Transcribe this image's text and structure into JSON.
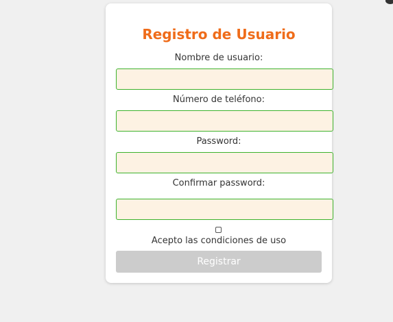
{
  "form": {
    "title": "Registro de Usuario",
    "username_label": "Nombre de usuario:",
    "username_value": "",
    "phone_label": "Número de teléfono:",
    "phone_value": "",
    "password_label": "Password:",
    "password_value": "",
    "confirm_label": "Confirmar password:",
    "confirm_value": "",
    "terms_label": "Acepto las condiciones de uso",
    "terms_checked": false,
    "submit_label": "Registrar"
  },
  "colors": {
    "title": "#ef6c1a",
    "input_background": "#fdf2e3",
    "input_border": "#3cb22b",
    "submit_background": "#cccccc",
    "page_background": "#f0f0f0"
  }
}
